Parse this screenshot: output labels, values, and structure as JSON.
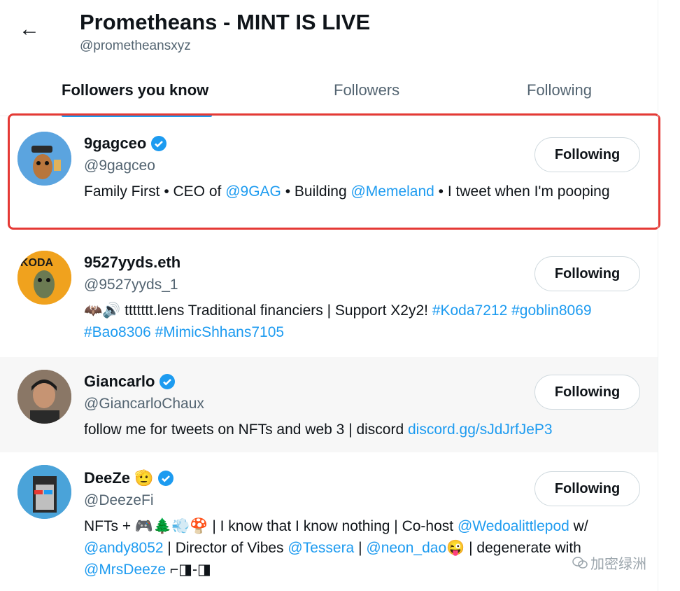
{
  "header": {
    "back_icon": "arrow-left-icon",
    "title": "Prometheans - MINT IS LIVE",
    "handle": "@prometheansxyz"
  },
  "tabs": [
    {
      "label": "Followers you know",
      "active": true
    },
    {
      "label": "Followers",
      "active": false
    },
    {
      "label": "Following",
      "active": false
    }
  ],
  "accent_color": "#1d9bf0",
  "highlight_color": "#e53935",
  "users": [
    {
      "name": "9gagceo",
      "handle": "@9gagceo",
      "verified": true,
      "button": "Following",
      "bio": [
        {
          "t": "Family First • CEO of "
        },
        {
          "t": "@9GAG",
          "link": true
        },
        {
          "t": " • Building "
        },
        {
          "t": "@Memeland",
          "link": true
        },
        {
          "t": " • I tweet when I'm pooping"
        }
      ]
    },
    {
      "name": "9527yyds.eth",
      "handle": "@9527yyds_1",
      "verified": false,
      "button": "Following",
      "bio": [
        {
          "t": "🦇🔊 ttttttt.lens Traditional financiers | Support X2y2! "
        },
        {
          "t": "#Koda7212",
          "link": true
        },
        {
          "t": " "
        },
        {
          "t": "#goblin8069",
          "link": true
        },
        {
          "t": " "
        },
        {
          "t": "#Bao8306",
          "link": true
        },
        {
          "t": " "
        },
        {
          "t": "#MimicShhans7105",
          "link": true
        }
      ]
    },
    {
      "name": "Giancarlo",
      "handle": "@GiancarloChaux",
      "verified": true,
      "button": "Following",
      "bio": [
        {
          "t": "follow me for tweets on NFTs and web 3 | discord "
        },
        {
          "t": "discord.gg/sJdJrfJeP3",
          "link": true
        }
      ]
    },
    {
      "name": "DeeZe",
      "name_emoji": "🫡",
      "handle": "@DeezeFi",
      "verified": true,
      "button": "Following",
      "bio": [
        {
          "t": "NFTs + 🎮🌲💨🍄 | I know that I know nothing | Co-host "
        },
        {
          "t": "@Wedoalittlepod",
          "link": true
        },
        {
          "t": " w/ "
        },
        {
          "t": "@andy8052",
          "link": true
        },
        {
          "t": " | Director of Vibes "
        },
        {
          "t": "@Tessera",
          "link": true
        },
        {
          "t": " | "
        },
        {
          "t": "@neon_dao",
          "link": true
        },
        {
          "t": "😜 | degenerate with "
        },
        {
          "t": "@MrsDeeze",
          "link": true
        },
        {
          "t": " ⌐◨-◨"
        }
      ]
    }
  ],
  "watermark": "加密绿洲"
}
